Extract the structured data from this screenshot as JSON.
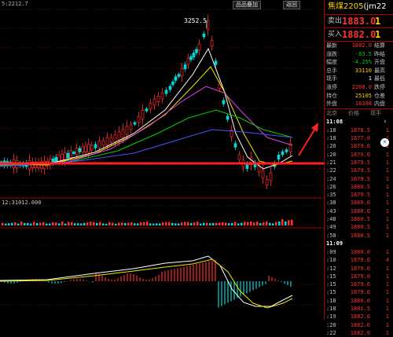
{
  "chart": {
    "ma_label": "5:2212.7",
    "peak_price": "3252.5",
    "sub_volume_label": "12:31012.000",
    "buttons": [
      "品品叠加",
      "返回"
    ]
  },
  "panel": {
    "title": "焦煤2205",
    "code": "(jm22",
    "sell_label": "卖出",
    "sell_price": "1883.0",
    "sell_vol": "1",
    "buy_label": "买入",
    "buy_price": "1882.0",
    "buy_vol": "1",
    "quotes": [
      {
        "k1": "最新",
        "v1": "1882.0",
        "k2": "结算",
        "c": "red"
      },
      {
        "k1": "涨跌",
        "v1": "-83.5",
        "k2": "昨结",
        "c": "green"
      },
      {
        "k1": "幅度",
        "v1": "-4.25%",
        "k2": "开盘",
        "c": "green"
      },
      {
        "k1": "总手",
        "v1": "33110",
        "k2": "最高",
        "c": "yellow"
      },
      {
        "k1": "现手",
        "v1": "1",
        "k2": "最低",
        "c": "white"
      },
      {
        "k1": "涨停",
        "v1": "2268.0",
        "k2": "跌停",
        "c": "red"
      },
      {
        "k1": "持仓",
        "v1": "25105",
        "k2": "仓差",
        "c": "yellow"
      },
      {
        "k1": "外盘",
        "v1": "16398",
        "k2": "内盘",
        "c": "red"
      }
    ],
    "tick_headers": [
      "北京",
      "价格",
      "现手"
    ],
    "tick_time1": "11:08",
    "ticks1": [
      {
        "t": ":18",
        "p": "1878.5",
        "v": "1"
      },
      {
        "t": ":18",
        "p": "1877.0",
        "v": "1"
      },
      {
        "t": ":20",
        "p": "1879.0",
        "v": "1"
      },
      {
        "t": ":20",
        "p": "1879.0",
        "v": "1"
      },
      {
        "t": ":21",
        "p": "1879.5",
        "v": "1"
      },
      {
        "t": ":22",
        "p": "1879.5",
        "v": "1"
      },
      {
        "t": ":24",
        "p": "1879.5",
        "v": "1"
      },
      {
        "t": ":26",
        "p": "1880.5",
        "v": "1"
      },
      {
        "t": ":35",
        "p": "1879.5",
        "v": "1"
      },
      {
        "t": ":38",
        "p": "1880.0",
        "v": "1"
      },
      {
        "t": ":43",
        "p": "1880.0",
        "v": "1"
      },
      {
        "t": ":48",
        "p": "1880.5",
        "v": "1"
      },
      {
        "t": ":49",
        "p": "1880.5",
        "v": "1"
      },
      {
        "t": ":58",
        "p": "1880.5",
        "v": "1"
      }
    ],
    "tick_time2": "11:09",
    "ticks2": [
      {
        "t": ":09",
        "p": "1880.0",
        "v": "1"
      },
      {
        "t": ":10",
        "p": "1879.0",
        "v": "4"
      },
      {
        "t": ":12",
        "p": "1879.0",
        "v": "1"
      },
      {
        "t": ":15",
        "p": "1879.0",
        "v": "1"
      },
      {
        "t": ":15",
        "p": "1879.0",
        "v": "1"
      },
      {
        "t": ":15",
        "p": "1879.0",
        "v": "1"
      },
      {
        "t": ":18",
        "p": "1880.0",
        "v": "1"
      },
      {
        "t": ":18",
        "p": "1881.5",
        "v": "1"
      },
      {
        "t": ":19",
        "p": "1882.0",
        "v": "1"
      },
      {
        "t": ":20",
        "p": "1882.0",
        "v": "1"
      },
      {
        "t": ":22",
        "p": "1882.0",
        "v": "1"
      }
    ]
  },
  "colors": {
    "up": "#ff3030",
    "down": "#00c8c8",
    "accent": "#ffd200",
    "line": "#ff2020"
  },
  "icons": [
    "arrow-up-icon",
    "scroll-right-icon",
    "close-icon"
  ]
}
